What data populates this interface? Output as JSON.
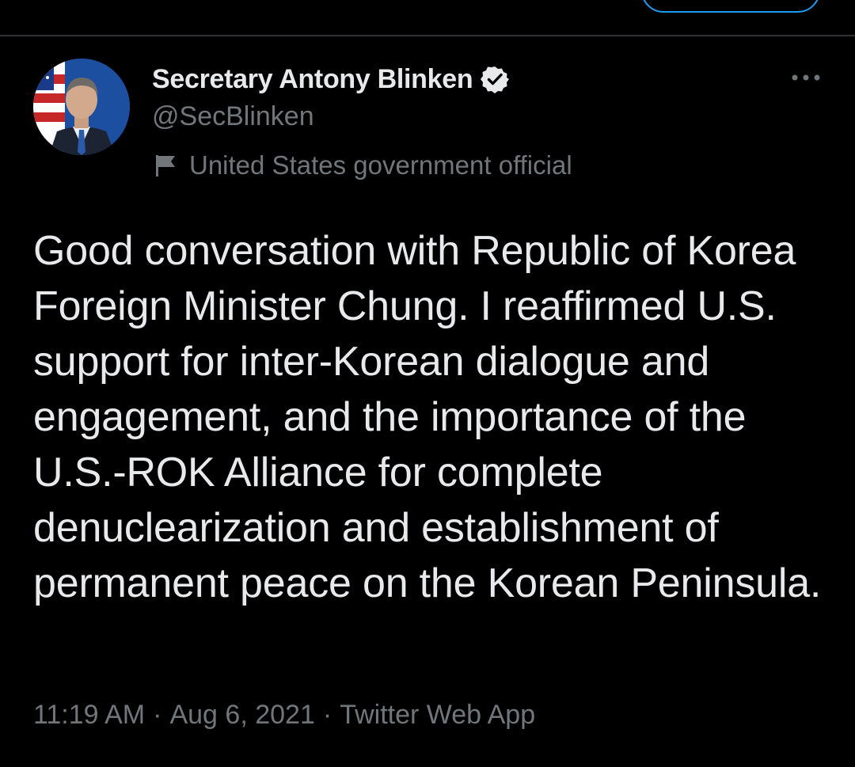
{
  "tweet": {
    "author": {
      "name": "Secretary Antony Blinken",
      "handle": "@SecBlinken",
      "verified": true,
      "label": "United States government official"
    },
    "text": "Good conversation with Republic of Korea Foreign Minister Chung. I reaffirmed U.S. support for inter-Korean dialogue and engagement, and the importance of the U.S.-ROK Alliance for complete denuclearization and establishment of permanent peace on the Korean Peninsula.",
    "time": "11:19 AM",
    "date": "Aug 6, 2021",
    "source": "Twitter Web App",
    "separator": "·"
  },
  "icons": {
    "verified": "verified-badge-icon",
    "flag": "flag-icon",
    "more": "more-options-icon"
  },
  "colors": {
    "background": "#000000",
    "primary_text": "#e7e9ea",
    "secondary_text": "#71767b",
    "accent": "#1d9bf0",
    "divider": "#2f3336"
  }
}
